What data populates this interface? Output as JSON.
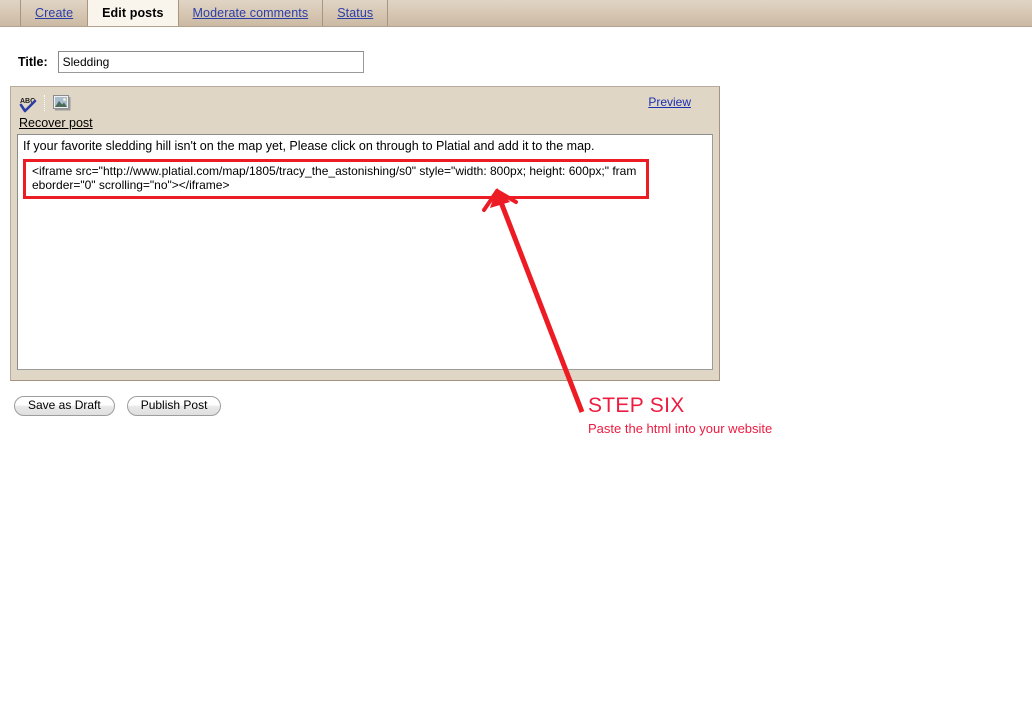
{
  "tabs": [
    {
      "label": "Create",
      "active": false
    },
    {
      "label": "Edit posts",
      "active": true
    },
    {
      "label": "Moderate comments",
      "active": false
    },
    {
      "label": "Status",
      "active": false
    }
  ],
  "title_field": {
    "label": "Title:",
    "value": "Sledding",
    "placeholder": ""
  },
  "editor": {
    "toolbar": {
      "spellcheck_icon": "abc-spellcheck-icon",
      "image_icon": "insert-image-icon",
      "preview_label": "Preview"
    },
    "recover_post_label": "Recover post",
    "body_text": "If your favorite sledding hill isn't on the map yet, Please click on through to Platial and add it to the map.",
    "code_snippet": "<iframe src=\"http://www.platial.com/map/1805/tracy_the_astonishing/s0\" style=\"width: 800px; height: 600px;\" frameborder=\"0\" scrolling=\"no\"></iframe>"
  },
  "buttons": {
    "save_draft_label": "Save as Draft",
    "publish_label": "Publish Post"
  },
  "annotation": {
    "step_title": "STEP SIX",
    "step_subtitle": "Paste the html into your website",
    "color": "#ed1c41",
    "highlight_color": "#ed1c24"
  }
}
